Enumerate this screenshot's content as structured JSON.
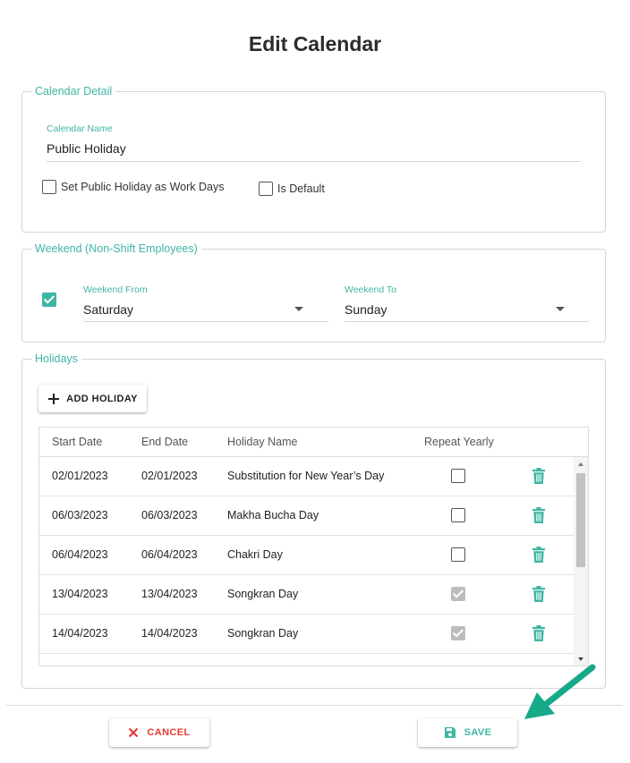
{
  "page": {
    "title": "Edit Calendar"
  },
  "calendar_detail": {
    "legend": "Calendar Detail",
    "name_label": "Calendar Name",
    "name_value": "Public Holiday",
    "workdays_label": "Set Public Holiday as Work Days",
    "workdays_checked": false,
    "default_label": "Is Default",
    "default_checked": false
  },
  "weekend": {
    "legend": "Weekend (Non-Shift Employees)",
    "enabled": true,
    "from_label": "Weekend From",
    "from_value": "Saturday",
    "to_label": "Weekend To",
    "to_value": "Sunday"
  },
  "holidays": {
    "legend": "Holidays",
    "add_label": "ADD HOLIDAY",
    "headers": [
      "Start Date",
      "End Date",
      "Holiday Name",
      "Repeat Yearly"
    ],
    "rows": [
      {
        "start": "02/01/2023",
        "end": "02/01/2023",
        "name": "Substitution for New Year’s Day",
        "repeat": false
      },
      {
        "start": "06/03/2023",
        "end": "06/03/2023",
        "name": "Makha Bucha Day",
        "repeat": false
      },
      {
        "start": "06/04/2023",
        "end": "06/04/2023",
        "name": "Chakri Day",
        "repeat": false
      },
      {
        "start": "13/04/2023",
        "end": "13/04/2023",
        "name": "Songkran Day",
        "repeat": true
      },
      {
        "start": "14/04/2023",
        "end": "14/04/2023",
        "name": "Songkran Day",
        "repeat": true
      }
    ]
  },
  "footer": {
    "cancel_label": "CANCEL",
    "save_label": "SAVE"
  },
  "colors": {
    "accent": "#3fb6a3",
    "cancel": "#e53935",
    "arrow": "#16a98a"
  },
  "icons": {
    "add": "plus-icon",
    "delete": "trash-icon",
    "cancel": "close-icon",
    "save": "floppy-disk-icon",
    "pointer": "arrow-icon"
  }
}
